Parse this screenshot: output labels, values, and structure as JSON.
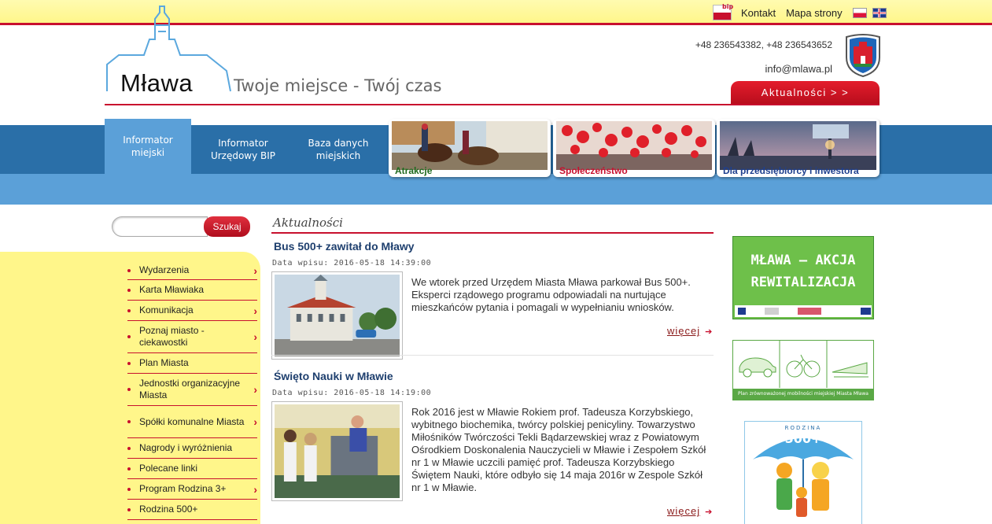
{
  "topbar": {
    "bip_label": "bip",
    "contact": "Kontakt",
    "sitemap": "Mapa strony"
  },
  "header": {
    "logo": "Mława",
    "tagline": "Twoje miejsce - Twój czas",
    "phones": "+48 236543382, +48 236543652",
    "email": "info@mlawa.pl",
    "news_button": "Aktualności > >"
  },
  "nav": {
    "items": [
      {
        "label": "Informator miejski"
      },
      {
        "label": "Informator Urzędowy BIP"
      },
      {
        "label": "Baza danych miejskich"
      }
    ],
    "tiles": [
      {
        "label": "Atrakcje",
        "color": "#1f6a1f"
      },
      {
        "label": "Społeczeństwo",
        "color": "#c8102e"
      },
      {
        "label": "Dla przedsiębiorcy i inwestora",
        "color": "#1e3f8e"
      }
    ]
  },
  "search": {
    "placeholder": "",
    "button": "Szukaj"
  },
  "menu": [
    {
      "label": "Wydarzenia",
      "chevron": true
    },
    {
      "label": "Karta Mławiaka",
      "chevron": false
    },
    {
      "label": "Komunikacja",
      "chevron": true
    },
    {
      "label": "Poznaj miasto - ciekawostki",
      "chevron": true
    },
    {
      "label": "Plan Miasta",
      "chevron": false
    },
    {
      "label": "Jednostki organizacyjne Miasta",
      "chevron": true
    },
    {
      "label": "Spółki komunalne Miasta",
      "chevron": true
    },
    {
      "label": "Nagrody i wyróżnienia",
      "chevron": false
    },
    {
      "label": "Polecane linki",
      "chevron": false
    },
    {
      "label": "Program Rodzina 3+",
      "chevron": true
    },
    {
      "label": "Rodzina 500+",
      "chevron": false
    }
  ],
  "news": {
    "heading": "Aktualności",
    "articles": [
      {
        "title": "Bus 500+ zawitał do Mławy",
        "date": "Data wpisu: 2016-05-18 14:39:00",
        "body": "We wtorek przed Urzędem Miasta Mława parkował Bus 500+. Eksperci rządowego programu odpowiadali na nurtujące mieszkańców pytania i pomagali w wypełnianiu wniosków.",
        "more": "więcej"
      },
      {
        "title": "Święto Nauki w Mławie",
        "date": "Data wpisu: 2016-05-18 14:19:00",
        "body": "Rok 2016 jest w Mławie Rokiem prof. Tadeusza Korzybskiego, wybitnego biochemika, twórcy polskiej penicyliny. Towarzystwo Miłośników Twórczości Tekli Bądarzewskiej wraz z Powiatowym Ośrodkiem Doskonalenia Nauczycieli w Mławie i Zespołem Szkół nr 1 w Mławie uczcili pamięć prof. Tadeusza Korzybskiego Świętem Nauki, które odbyło się 14 maja 2016r w Zespole Szkół nr 1 w Mławie.",
        "more": "więcej"
      }
    ]
  },
  "banners": {
    "rewit_line1": "MŁAWA – AKCJA",
    "rewit_line2": "REWITALIZACJA",
    "mobility": "Plan zrównoważonej mobilności miejskiej Miasta Mława",
    "rodzina_top": "RODZINA",
    "rodzina_num": "500+"
  },
  "colors": {
    "brand_red": "#c8102e",
    "nav_blue": "#2a6fa8",
    "nav_light": "#5ba0d8",
    "yellow": "#fff68a"
  }
}
